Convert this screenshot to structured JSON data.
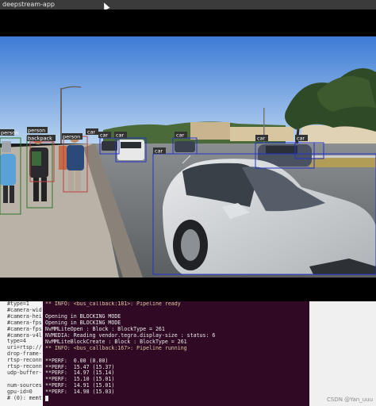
{
  "window": {
    "title": "deepstream-app"
  },
  "detections": [
    {
      "label": "person",
      "color": "#2a7a2a"
    },
    {
      "label": "backpack",
      "color": "#6a3a3a"
    },
    {
      "label": "person",
      "color": "#2a7a2a"
    },
    {
      "label": "person",
      "color": "#2a7a2a"
    },
    {
      "label": "car",
      "color": "#2233cc"
    },
    {
      "label": "car",
      "color": "#2233cc"
    },
    {
      "label": "car",
      "color": "#2233cc"
    },
    {
      "label": "car",
      "color": "#2233cc"
    },
    {
      "label": "car",
      "color": "#2233cc"
    },
    {
      "label": "car",
      "color": "#2233cc"
    },
    {
      "label": "car",
      "color": "#2233cc"
    }
  ],
  "terminal_left": {
    "lines": [
      "#type=1",
      "#camera-wid",
      "#camera-hei",
      "#camera-fps",
      "#camera-fps",
      "#camera-v4l",
      "type=4",
      "uri=rtsp://",
      "drop-frame-",
      "rtsp-reconn",
      "rtsp-reconn",
      "udp-buffer-",
      "",
      "num-sources",
      "gpu-id=0",
      "# (0): memt"
    ]
  },
  "terminal_main": {
    "lines": [
      "** INFO: <bus_callback:181>: Pipeline ready",
      "",
      "Opening in BLOCKING MODE",
      "Opening in BLOCKING MODE",
      "NvMMLiteOpen : Block : BlockType = 261",
      "NVMEDIA: Reading vendor.tegra.display-size : status: 6",
      "NvMMLiteBlockCreate : Block : BlockType = 261",
      "** INFO: <bus_callback:167>: Pipeline running",
      "",
      "**PERF:  0.00 (0.00)",
      "**PERF:  15.47 (15.37)",
      "**PERF:  14.97 (15.14)",
      "**PERF:  15.10 (15.01)",
      "**PERF:  14.91 (15.01)",
      "**PERF:  14.98 (15.03)",
      ""
    ]
  },
  "watermark": "CSDN @Yan_uuu"
}
